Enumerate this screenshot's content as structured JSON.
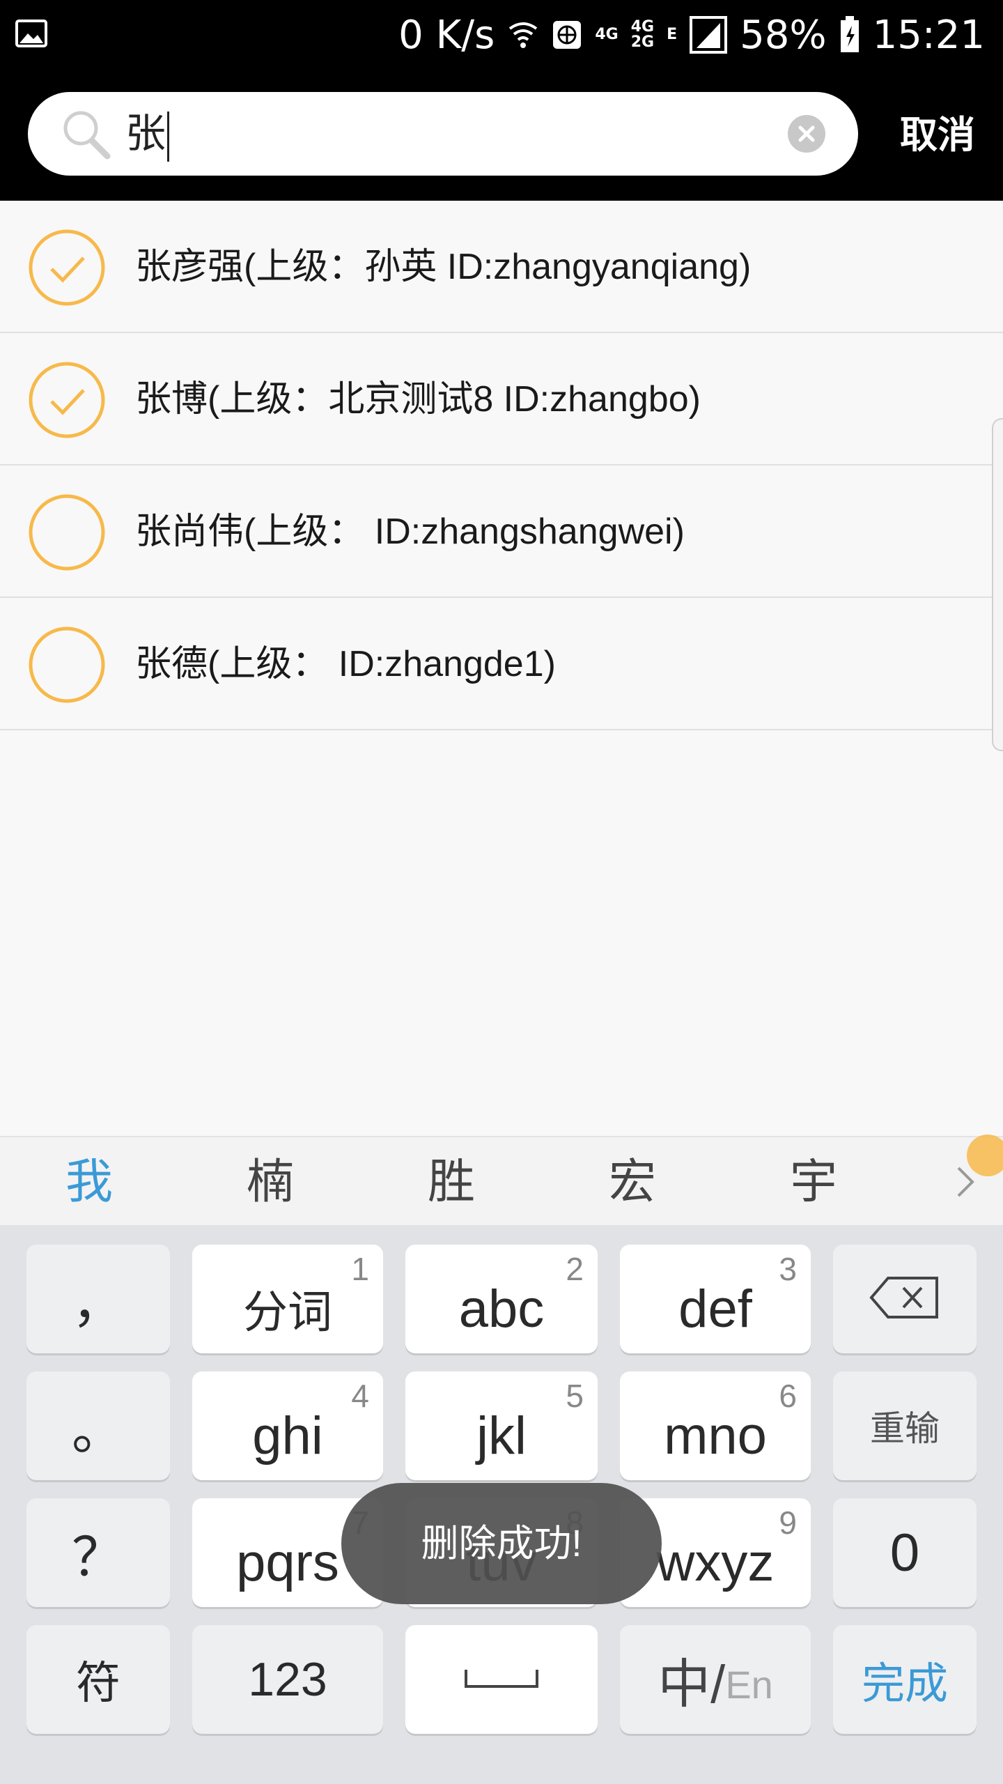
{
  "status_bar": {
    "speed": "0 K/s",
    "network_4g": "4G",
    "network_4g2g_top": "4G",
    "network_4g2g_bottom": "2G",
    "network_e": "E",
    "battery": "58%",
    "time": "15:21"
  },
  "search": {
    "query": "张",
    "cancel_label": "取消"
  },
  "results": [
    {
      "label": "张彦强(上级：孙英 ID:zhangyanqiang)",
      "checked": true
    },
    {
      "label": "张博(上级：北京测试8 ID:zhangbo)",
      "checked": true
    },
    {
      "label": "张尚伟(上级： ID:zhangshangwei)",
      "checked": false
    },
    {
      "label": "张德(上级： ID:zhangde1)",
      "checked": false
    }
  ],
  "candidates": [
    "我",
    "楠",
    "胜",
    "宏",
    "宇"
  ],
  "keyboard": {
    "comma": "，",
    "period": "。",
    "question": "？",
    "symbol": "符",
    "fenci": "分词",
    "fenci_num": "1",
    "abc": "abc",
    "abc_num": "2",
    "def": "def",
    "def_num": "3",
    "ghi": "ghi",
    "ghi_num": "4",
    "jkl": "jkl",
    "jkl_num": "5",
    "mno": "mno",
    "mno_num": "6",
    "pqrs": "pqrs",
    "pqrs_num": "7",
    "tuv": "tuv",
    "tuv_num": "8",
    "wxyz": "wxyz",
    "wxyz_num": "9",
    "reset": "重输",
    "zero": "0",
    "num_mode": "123",
    "lang_cn": "中/",
    "lang_en": "En",
    "done": "完成"
  },
  "toast": "删除成功!",
  "colors": {
    "accent_orange": "#f7b94a",
    "accent_blue": "#3b9ad6"
  }
}
